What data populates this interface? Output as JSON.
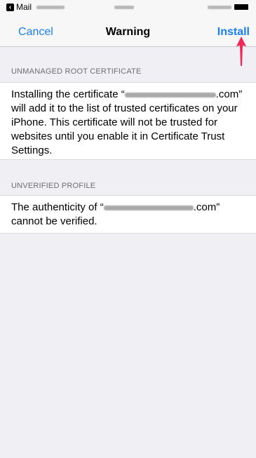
{
  "status_bar": {
    "back_app_label": "Mail"
  },
  "nav": {
    "cancel_label": "Cancel",
    "title": "Warning",
    "install_label": "Install"
  },
  "sections": [
    {
      "header": "UNMANAGED ROOT CERTIFICATE",
      "body_prefix": "Installing the certificate “",
      "body_suffix": ".com” will add it to the list of trusted certificates on your iPhone. This certificate will not be trusted for websites until you enable it in Certificate Trust Settings."
    },
    {
      "header": "UNVERIFIED PROFILE",
      "body_prefix": "The authenticity of “",
      "body_suffix": ".com” cannot be verified."
    }
  ],
  "colors": {
    "accent": "#1a7ff5",
    "annotation_arrow": "#f0295b",
    "background": "#efeff4"
  }
}
